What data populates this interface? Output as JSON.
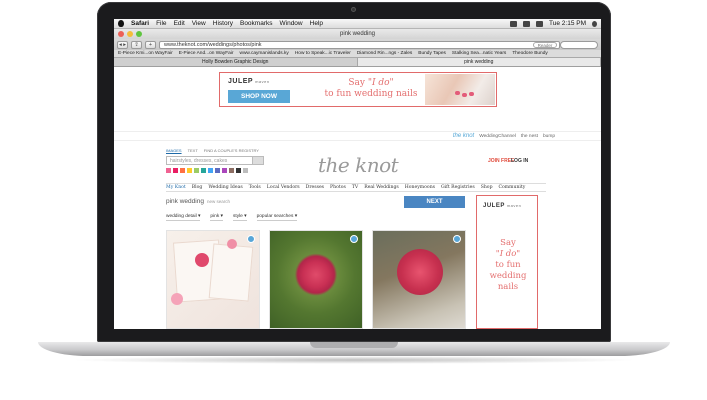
{
  "menubar": {
    "app": "Safari",
    "items": [
      "File",
      "Edit",
      "View",
      "History",
      "Bookmarks",
      "Window",
      "Help"
    ],
    "clock": "Tue 2:15 PM"
  },
  "window": {
    "title": "pink wedding",
    "back_label": "◂ ▸",
    "url": "www.theknot.com/weddings/photos/pink",
    "reader_label": "Reader"
  },
  "bookmarks": [
    "E-Piece Kmi...on WayFair",
    "E-Piece And...on WayFair",
    "www.caymanislands.ky",
    "How to Speak...ic Traveler",
    "Diamond Rin...ngs - Zales",
    "Bundy Tapes",
    "Stalking Sea...natic Years",
    "Theodore Bundy"
  ],
  "tabs": [
    {
      "label": "Holly Bowden Graphic Design",
      "active": false
    },
    {
      "label": "pink wedding",
      "active": true
    }
  ],
  "top_ad": {
    "brand": "JULEP",
    "brand_sub": "maven",
    "cta": "SHOP NOW",
    "line1": "Say",
    "line1_em": "\"I do\"",
    "line2": "to fun wedding nails"
  },
  "util": {
    "knot": "the knot",
    "items": [
      "WeddingChannel",
      "the nest",
      "bump"
    ]
  },
  "header": {
    "search_tabs": [
      "IMAGES",
      "TEXT",
      "FIND A COUPLE'S REGISTRY"
    ],
    "search_placeholder": "hairstyles, dresses, cakes",
    "logo": "the knot",
    "join": "JOIN FREE",
    "login": "LOG IN",
    "swatch_colors": [
      "#f06292",
      "#e91e63",
      "#ff7043",
      "#ffca28",
      "#9ccc65",
      "#26a69a",
      "#42a5f5",
      "#5c6bc0",
      "#ab47bc",
      "#8d6e63",
      "#333333",
      "#bdbdbd"
    ]
  },
  "nav": [
    "My Knot",
    "Blog",
    "Wedding Ideas",
    "Tools",
    "Local Vendors",
    "Dresses",
    "Photos",
    "TV",
    "Real Weddings",
    "Honeymoons",
    "Gift Registries",
    "Shop",
    "Community"
  ],
  "results": {
    "title": "pink wedding",
    "new_search": "new search",
    "next": "NEXT",
    "filters": [
      "wedding detail ▾",
      "pink ▾",
      "style ▾",
      "popular searches ▾"
    ]
  },
  "side_ad": {
    "brand": "JULEP",
    "brand_sub": "maven",
    "lines": [
      "Say",
      "\"I do\"",
      "to fun",
      "wedding",
      "nails"
    ]
  },
  "dock_colors": [
    "#5a8fd8",
    "#9aa0a8",
    "#6b7a8f",
    "#3d88e0",
    "#d4a44d",
    "#8b6b3f",
    "#c7c9cc",
    "#3a6fd1",
    "#4a4a4a",
    "#1e73d9",
    "#e9a33b",
    "#8e8e93",
    "#3277d6",
    "#e8562a",
    "#1f7a3e",
    "#f29c1f",
    "#d44d2c",
    "#7b3fbf",
    "#e85c2a",
    "#5dade2",
    "#d0d0d0",
    "#6e7f8f",
    "#9a9a9a"
  ]
}
